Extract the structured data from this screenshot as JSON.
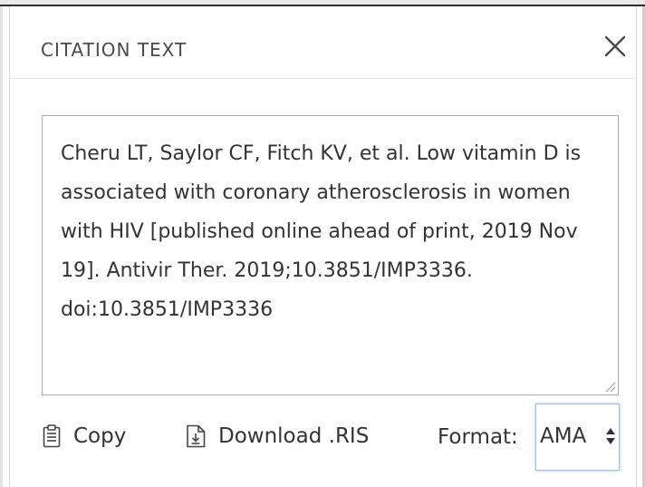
{
  "dialog": {
    "title": "CITATION TEXT",
    "close_icon": "close-icon"
  },
  "citation": {
    "text": "Cheru LT, Saylor CF, Fitch KV, et al. Low vitamin D is associated with coronary atherosclerosis in women with HIV [published online ahead of print, 2019 Nov 19]. Antivir Ther. 2019;10.3851/IMP3336. doi:10.3851/IMP3336"
  },
  "footer": {
    "copy_label": "Copy",
    "copy_icon": "clipboard-icon",
    "download_label": "Download .RIS",
    "download_icon": "download-file-icon",
    "format_label": "Format:",
    "format_value": "AMA",
    "format_icon": "up-down-arrows-icon"
  },
  "colors": {
    "text": "#333333",
    "border": "#a9a9a9",
    "focus_ring": "#9ec3e6"
  }
}
